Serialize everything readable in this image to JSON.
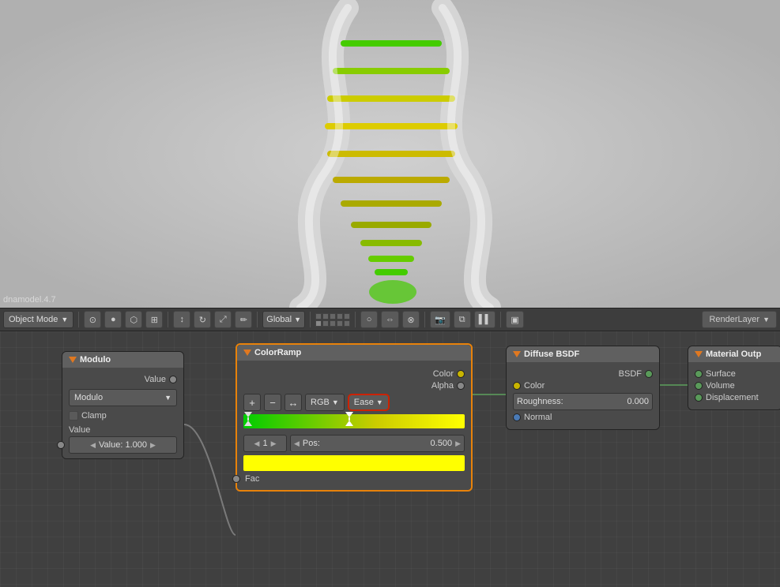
{
  "viewport": {
    "info_text": "dnamodel.4.7"
  },
  "toolbar": {
    "mode_label": "Object Mode",
    "global_label": "Global",
    "render_layer_label": "RenderLayer"
  },
  "nodes": {
    "modulo": {
      "title": "Modulo",
      "output_label": "Value",
      "type_label": "Modulo",
      "clamp_label": "Clamp",
      "value_label": "Value",
      "value_field": "Value: 1.000"
    },
    "colorramp": {
      "title": "ColorRamp",
      "output_color_label": "Color",
      "output_alpha_label": "Alpha",
      "input_fac_label": "Fac",
      "add_btn": "+",
      "remove_btn": "−",
      "interpolate_btn": "↔",
      "rgb_label": "RGB",
      "ease_label": "Ease",
      "stop_number": "1",
      "pos_label": "Pos:",
      "pos_value": "0.500"
    },
    "diffuse": {
      "title": "Diffuse BSDF",
      "bsdf_label": "BSDF",
      "color_label": "Color",
      "roughness_label": "Roughness:",
      "roughness_value": "0.000",
      "normal_label": "Normal"
    },
    "material_output": {
      "title": "Material Outp",
      "surface_label": "Surface",
      "volume_label": "Volume",
      "displacement_label": "Displacement"
    }
  },
  "icons": {
    "triangle_down": "▼",
    "triangle_right": "▶",
    "arrow_lr": "↔",
    "chevron_left": "◀",
    "chevron_right": "▶",
    "plus": "+",
    "minus": "−"
  }
}
